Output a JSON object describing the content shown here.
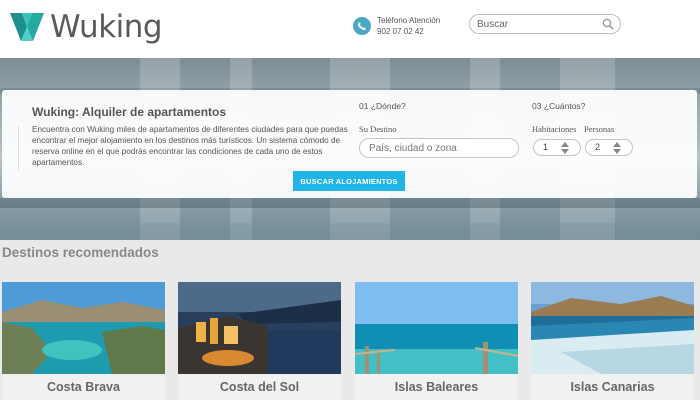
{
  "header": {
    "brand": "Wuking",
    "phone_label": "Teléfono Atención",
    "phone_number": "902 07 02 42",
    "search_placeholder": "Buscar"
  },
  "booking": {
    "title": "Wuking: Alquiler de apartamentos",
    "description": "Encuentra con Wuking miles de apartamentos de diferentes ciudades para que puedas encontrar el mejor alojamiento en los destinos más turísticos. Un sistema cómodo de reserva online en el que podrás encontrar las condiciones de cada uno de estos apartamentos.",
    "button_label": "Buscar alojamientos",
    "step1_label": "01 ¿Dónde?",
    "destination_label": "Su Destino",
    "destination_placeholder": "País, ciudad o zona",
    "step3_label": "03 ¿Cuántos?",
    "rooms_label": "Habitaciones",
    "rooms_value": "1",
    "people_label": "Personas",
    "people_value": "2"
  },
  "destinations": {
    "title": "Destinos recomendados",
    "items": [
      {
        "name": "Costa Brava"
      },
      {
        "name": "Costa del Sol"
      },
      {
        "name": "Islas Baleares"
      },
      {
        "name": "Islas Canarias"
      }
    ]
  },
  "colors": {
    "accent": "#1fb5e8",
    "logo": "#2bb5b0",
    "phone_icon": "#4aa8c3"
  },
  "icons": [
    "wuking-logo-icon",
    "phone-icon",
    "search-icon",
    "stepper-arrows-icon"
  ]
}
